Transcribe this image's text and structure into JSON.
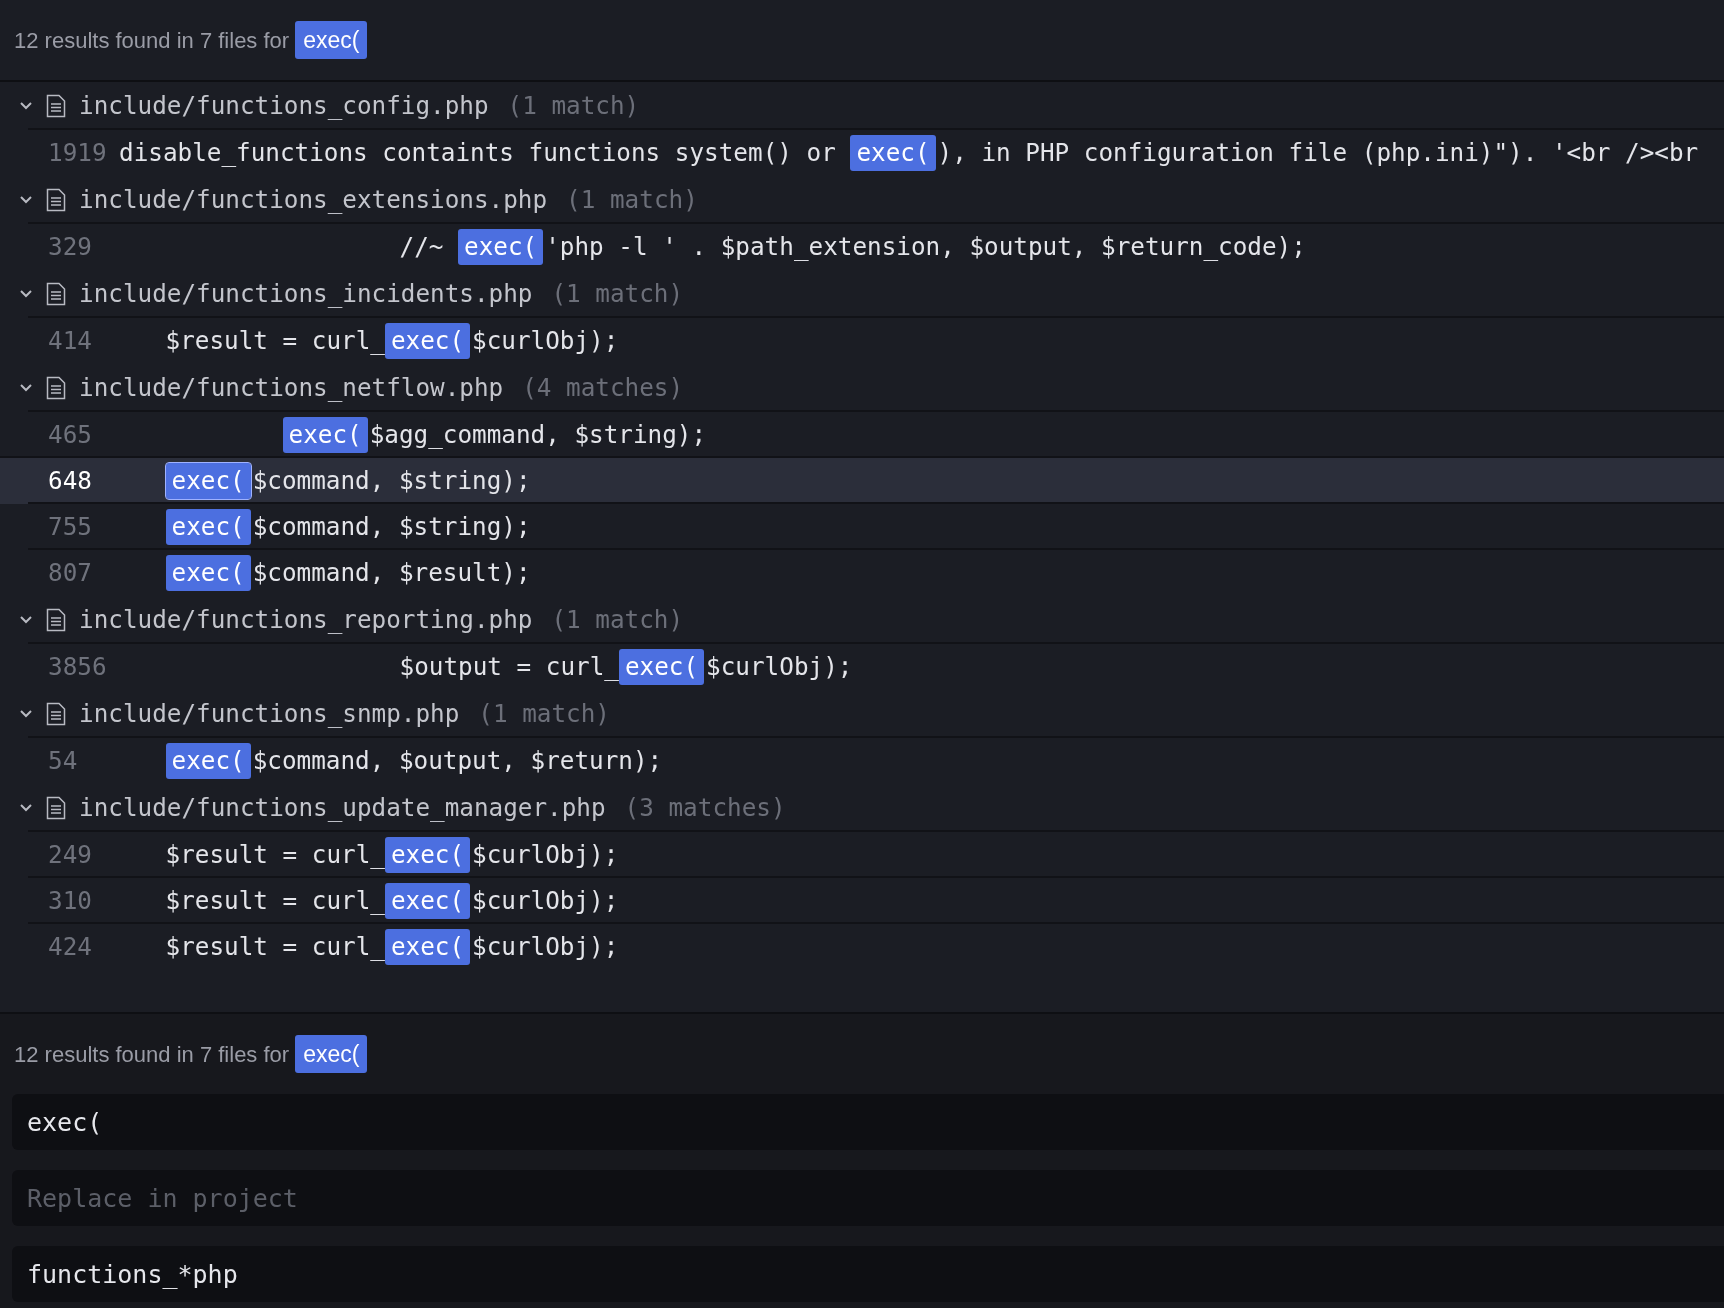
{
  "summary": {
    "text": "12 results found in 7 files for",
    "query": "exec("
  },
  "files": [
    {
      "path": "include/functions_config.php",
      "count": "(1 match)",
      "expanded": true,
      "matches": [
        {
          "line": "1919",
          "selected": false,
          "kind": "flat",
          "before": "disable_functions containts functions system() or ",
          "match": "exec(",
          "after": "), in PHP configuration file (php.ini)\"). '<br /><br"
        }
      ]
    },
    {
      "path": "include/functions_extensions.php",
      "count": "(1 match)",
      "expanded": true,
      "matches": [
        {
          "line": "329",
          "selected": false,
          "kind": "deep",
          "before": "//~ ",
          "match": "exec(",
          "after": "'php -l ' . $path_extension, $output, $return_code);"
        }
      ]
    },
    {
      "path": "include/functions_incidents.php",
      "count": "(1 match)",
      "expanded": true,
      "matches": [
        {
          "line": "414",
          "selected": false,
          "kind": "indented",
          "before": "$result = curl_",
          "match": "exec(",
          "after": "$curlObj);"
        }
      ]
    },
    {
      "path": "include/functions_netflow.php",
      "count": "(4 matches)",
      "expanded": true,
      "matches": [
        {
          "line": "465",
          "selected": false,
          "kind": "nested",
          "match": "exec(",
          "after": "$agg_command, $string);"
        },
        {
          "line": "648",
          "selected": true,
          "kind": "indented",
          "match": "exec(",
          "after": "$command, $string);"
        },
        {
          "line": "755",
          "selected": false,
          "kind": "indented",
          "match": "exec(",
          "after": "$command, $string);"
        },
        {
          "line": "807",
          "selected": false,
          "kind": "indented",
          "match": "exec(",
          "after": "$command, $result);"
        }
      ]
    },
    {
      "path": "include/functions_reporting.php",
      "count": "(1 match)",
      "expanded": true,
      "matches": [
        {
          "line": "3856",
          "selected": false,
          "kind": "deep",
          "before": "$output = curl_",
          "match": "exec(",
          "after": "$curlObj);"
        }
      ]
    },
    {
      "path": "include/functions_snmp.php",
      "count": "(1 match)",
      "expanded": true,
      "matches": [
        {
          "line": "54",
          "selected": false,
          "kind": "indented",
          "match": "exec(",
          "after": "$command, $output, $return);"
        }
      ]
    },
    {
      "path": "include/functions_update_manager.php",
      "count": "(3 matches)",
      "expanded": true,
      "matches": [
        {
          "line": "249",
          "selected": false,
          "kind": "indented",
          "before": "$result = curl_",
          "match": "exec(",
          "after": "$curlObj);"
        },
        {
          "line": "310",
          "selected": false,
          "kind": "indented",
          "before": "$result = curl_",
          "match": "exec(",
          "after": "$curlObj);"
        },
        {
          "line": "424",
          "selected": false,
          "kind": "indented",
          "before": "$result = curl_",
          "match": "exec(",
          "after": "$curlObj);"
        }
      ]
    }
  ],
  "footer": {
    "summary": {
      "text": "12 results found in 7 files for",
      "query": "exec("
    },
    "find": {
      "value": "exec("
    },
    "replace": {
      "placeholder": "Replace in project"
    },
    "file_filter": {
      "value": "functions_*php"
    }
  }
}
